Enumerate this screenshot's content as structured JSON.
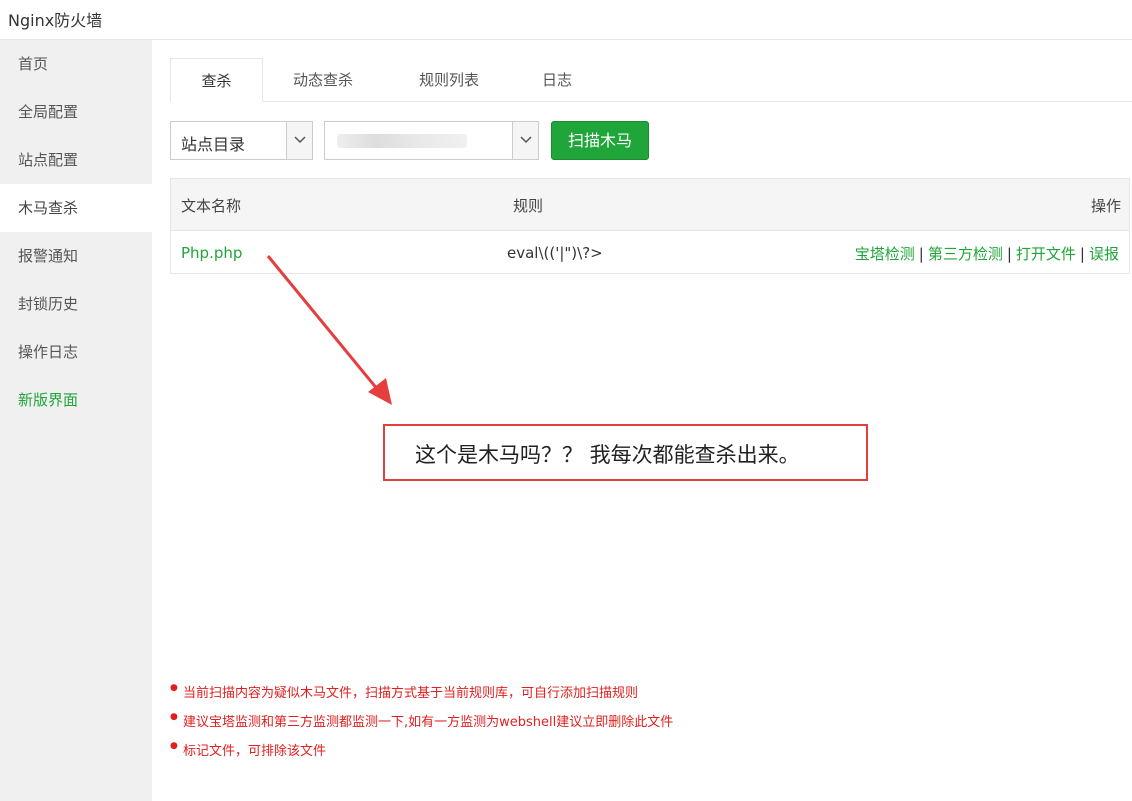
{
  "window": {
    "title": "Nginx防火墙"
  },
  "sidebar": {
    "items": [
      {
        "label": "首页"
      },
      {
        "label": "全局配置"
      },
      {
        "label": "站点配置"
      },
      {
        "label": "木马查杀"
      },
      {
        "label": "报警通知"
      },
      {
        "label": "封锁历史"
      },
      {
        "label": "操作日志"
      },
      {
        "label": "新版界面"
      }
    ],
    "active_index": 3
  },
  "tabs": [
    {
      "label": "查杀"
    },
    {
      "label": "动态查杀"
    },
    {
      "label": "规则列表"
    },
    {
      "label": "日志"
    }
  ],
  "toolbar": {
    "dir_select": "站点目录",
    "path_select": "",
    "scan_label": "扫描木马"
  },
  "table": {
    "headers": {
      "name": "文本名称",
      "rule": "规则",
      "ops": "操作"
    },
    "rows": [
      {
        "name": "Php.php",
        "rule": "eval\\(('|\")\\?>",
        "ops": [
          "宝塔检测",
          "第三方检测",
          "打开文件",
          "误报"
        ],
        "sep": "|"
      }
    ]
  },
  "annotation": {
    "text": "这个是木马吗？？ 我每次都能查杀出来。"
  },
  "notes": [
    "当前扫描内容为疑似木马文件，扫描方式基于当前规则库，可自行添加扫描规则",
    "建议宝塔监测和第三方监测都监测一下,如有一方监测为webshell建议立即删除此文件",
    "标记文件，可排除该文件"
  ],
  "colors": {
    "accent": "#20a53a",
    "annotation": "#e53e3e",
    "note": "#e02020"
  }
}
